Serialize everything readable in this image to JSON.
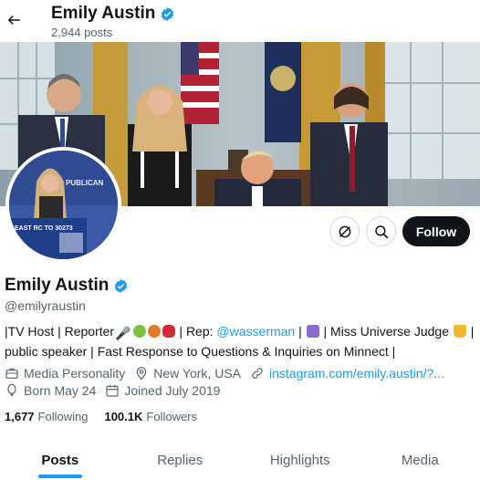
{
  "header": {
    "name": "Emily Austin",
    "posts": "2,944 posts"
  },
  "profile": {
    "name": "Emily Austin",
    "handle": "@emilyraustin",
    "follow_label": "Follow",
    "avatar_sign_text": "PUBLICAN",
    "avatar_podium_text": "EAST RC TO 30273"
  },
  "bio": {
    "part1": "|TV Host | Reporter",
    "part2": " | Rep: ",
    "mention": "@wasserman",
    "part3": " | ",
    "part4": " | Miss Universe Judge ",
    "part5": " | public speaker | Fast Response to Questions & Inquiries on Minnect |"
  },
  "meta": {
    "category": "Media Personality",
    "location": "New York, USA",
    "website": "instagram.com/emily.austin/?...",
    "born": "Born May 24",
    "joined": "Joined July 2019"
  },
  "stats": {
    "following_count": "1,677",
    "following_label": "Following",
    "followers_count": "100.1K",
    "followers_label": "Followers"
  },
  "tabs": {
    "posts": "Posts",
    "replies": "Replies",
    "highlights": "Highlights",
    "media": "Media"
  },
  "colors": {
    "verified": "#1d9bf0",
    "link": "#1d9bf0",
    "follow_button": "#0f1419",
    "muted_text": "#536471"
  },
  "icons": [
    "back-arrow-icon",
    "verified-badge-icon",
    "subscribe-icon",
    "search-icon",
    "briefcase-icon",
    "location-pin-icon",
    "link-icon",
    "balloon-icon",
    "calendar-icon"
  ]
}
